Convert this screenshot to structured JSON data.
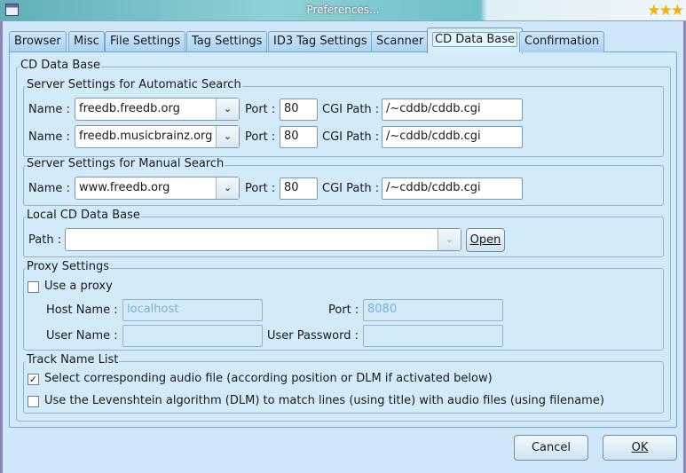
{
  "window": {
    "title": "Preferences...",
    "stars": "★★★"
  },
  "tabs": [
    {
      "label": "Browser"
    },
    {
      "label": "Misc"
    },
    {
      "label": "File Settings"
    },
    {
      "label": "Tag Settings"
    },
    {
      "label": "ID3 Tag Settings"
    },
    {
      "label": "Scanner"
    },
    {
      "label": "CD Data Base",
      "active": true
    },
    {
      "label": "Confirmation"
    }
  ],
  "cddb": {
    "title": "CD Data Base",
    "auto": {
      "title": "Server Settings for Automatic Search",
      "rows": [
        {
          "name_label": "Name :",
          "name": "freedb.freedb.org",
          "port_label": "Port :",
          "port": "80",
          "cgi_label": "CGI Path :",
          "cgi": "/~cddb/cddb.cgi"
        },
        {
          "name_label": "Name :",
          "name": "freedb.musicbrainz.org",
          "port_label": "Port :",
          "port": "80",
          "cgi_label": "CGI Path :",
          "cgi": "/~cddb/cddb.cgi"
        }
      ]
    },
    "manual": {
      "title": "Server Settings for Manual Search",
      "row": {
        "name_label": "Name :",
        "name": "www.freedb.org",
        "port_label": "Port :",
        "port": "80",
        "cgi_label": "CGI Path :",
        "cgi": "/~cddb/cddb.cgi"
      }
    },
    "local": {
      "title": "Local CD Data Base",
      "path_label": "Path :",
      "path": "",
      "open": "Open"
    },
    "proxy": {
      "title": "Proxy Settings",
      "use_proxy": "Use a proxy",
      "use_proxy_checked": false,
      "host_label": "Host Name :",
      "host": "localhost",
      "port_label": "Port :",
      "port": "8080",
      "user_label": "User Name :",
      "user": "",
      "password_label": "User Password :",
      "password": ""
    },
    "track": {
      "title": "Track Name List",
      "select_label": "Select corresponding audio file (according position or DLM if activated below)",
      "select_checked": true,
      "dlm_label": "Use the Levenshtein algorithm (DLM) to match lines (using title) with audio files (using filename)",
      "dlm_checked": false
    }
  },
  "buttons": {
    "cancel": "Cancel",
    "ok": "OK"
  }
}
